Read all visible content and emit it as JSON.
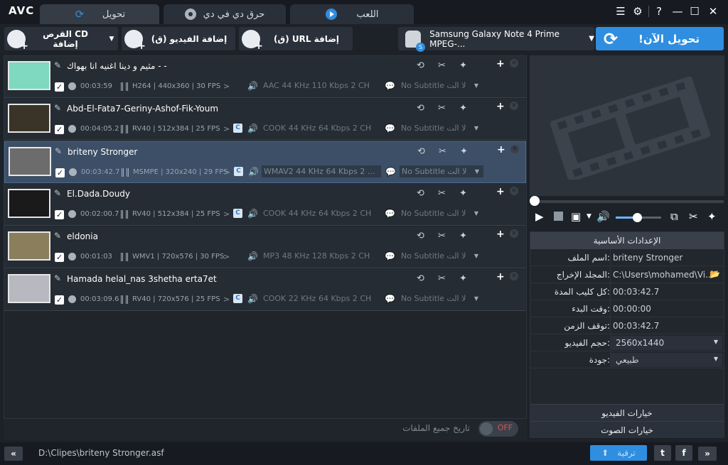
{
  "app": {
    "logo": "AVC",
    "tabs": [
      {
        "label": "تحويل",
        "icon": "convert-icon",
        "active": true
      },
      {
        "label": "حرق دي في دي",
        "icon": "disc-icon",
        "active": false
      },
      {
        "label": "اللعب",
        "icon": "play-icon",
        "active": false
      }
    ]
  },
  "toolbar": {
    "add_cd_label": "القرص CD إضافة",
    "add_video_label": "إضافة الفيديو (ق)",
    "add_url_label": "(ق) URL إضافة",
    "device_profile": "Samsung Galaxy Note 4 Prime MPEG-...",
    "convert_now_label": "!تحويل الآن"
  },
  "files": [
    {
      "name": "مثيم و دينا اغنيه انا بهواك - -",
      "duration": "00:03:59",
      "video_info": "H264 | 440x360 | 30 FPS",
      "audio_info": "AAC 44 KHz 110 Kbps 2 CH",
      "subtitle": "No Subtitle لا الت",
      "has_c_badge": false,
      "selected": false,
      "thumb": "#7fd8c0"
    },
    {
      "name": "Abd-El-Fata7-Geriny-Ashof-Fik-Youm",
      "duration": "00:04:05.2",
      "video_info": "RV40 | 512x384 | 25 FPS",
      "audio_info": "COOK 44 KHz 64 Kbps 2 CH",
      "subtitle": "No Subtitle لا الت",
      "has_c_badge": true,
      "selected": false,
      "thumb": "#3a3428"
    },
    {
      "name": "briteny Stronger",
      "duration": "00:03:42.7",
      "video_info": "MSMPE | 320x240 | 29 FPS",
      "audio_info": "WMAV2 44 KHz 64 Kbps 2 ...",
      "subtitle": "No Subtitle لا الت",
      "has_c_badge": true,
      "selected": true,
      "thumb": "#6c6c6c"
    },
    {
      "name": "El.Dada.Doudy",
      "duration": "00:02:00.7",
      "video_info": "RV40 | 512x384 | 25 FPS",
      "audio_info": "COOK 44 KHz 64 Kbps 2 CH",
      "subtitle": "No Subtitle لا الت",
      "has_c_badge": true,
      "selected": false,
      "thumb": "#1a1a1a"
    },
    {
      "name": "eldonia",
      "duration": "00:01:03",
      "video_info": "WMV1 | 720x576 | 30 FPS",
      "audio_info": "MP3 48 KHz 128 Kbps 2 CH",
      "subtitle": "No Subtitle لا الت",
      "has_c_badge": false,
      "selected": false,
      "thumb": "#8a7e5c"
    },
    {
      "name": "Hamada helal_nas 3shetha erta7et",
      "duration": "00:03:09.6",
      "video_info": "RV40 | 720x576 | 25 FPS",
      "audio_info": "COOK 22 KHz 64 Kbps 2 CH",
      "subtitle": "No Subtitle لا الت",
      "has_c_badge": true,
      "selected": false,
      "thumb": "#b8b8c0"
    }
  ],
  "merge": {
    "label": "تاريخ جميع الملفات",
    "toggle": "OFF"
  },
  "settings": {
    "header": "الإعدادات الأساسية",
    "rows": [
      {
        "label": "اسم الملف:",
        "value": "briteny Stronger",
        "type": "text"
      },
      {
        "label": "المجلد الإخراج:",
        "value": "C:\\Users\\mohamed\\Vi...",
        "type": "folder"
      },
      {
        "label": "كل كليب المدة:",
        "value": "00:03:42.7",
        "type": "text"
      },
      {
        "label": "وقت البدء:",
        "value": "00:00:00",
        "type": "text"
      },
      {
        "label": "توقف الزمن:",
        "value": "00:03:42.7",
        "type": "text"
      },
      {
        "label": "حجم الفيديو:",
        "value": "2560x1440",
        "type": "dropdown"
      },
      {
        "label": "جودة:",
        "value": "طبيعي",
        "type": "dropdown"
      }
    ],
    "video_options": "خيارات الفيديو",
    "audio_options": "خيارات الصوت"
  },
  "status": {
    "path": "D:\\Clipes\\briteny Stronger.asf",
    "upgrade_label": "ترقية"
  },
  "colors": {
    "accent": "#2f8ee0",
    "toggle_off": "#d9534f",
    "selected_row": "#3c4f67"
  }
}
